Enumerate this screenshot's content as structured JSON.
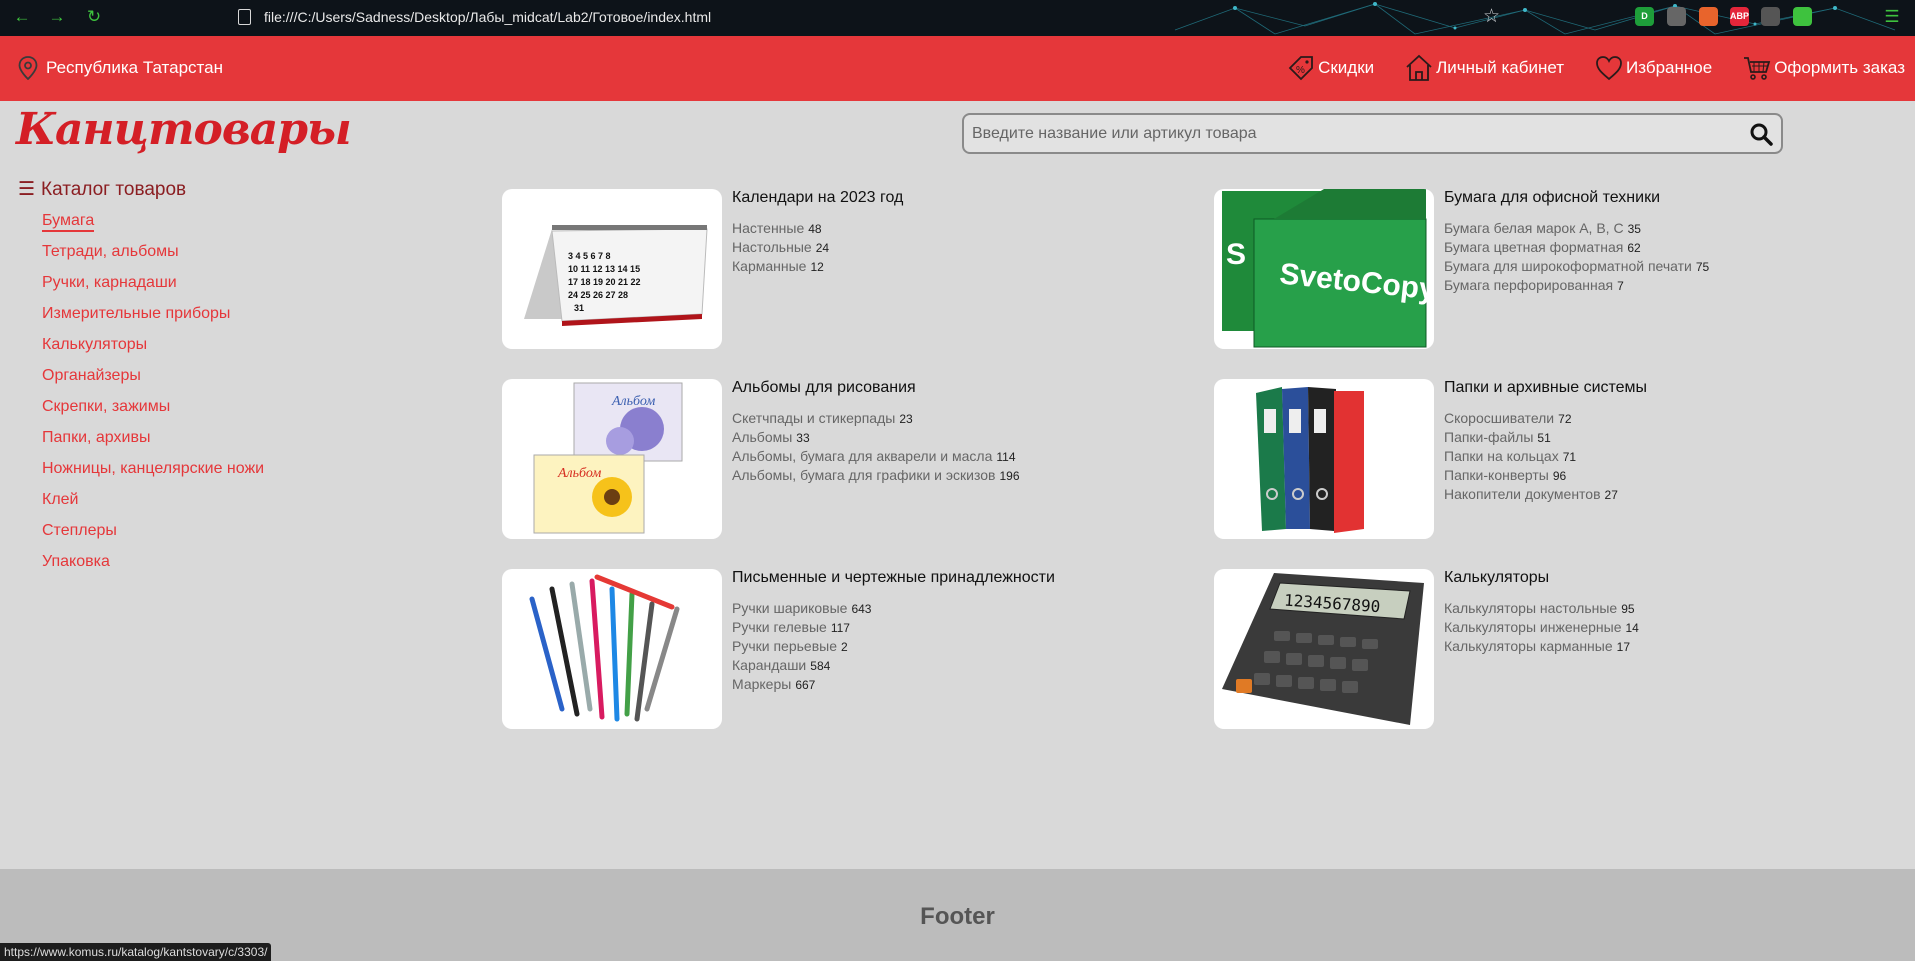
{
  "browser": {
    "url": "file:///C:/Users/Sadness/Desktop/Лабы_midcat/Lab2/Готовое/index.html",
    "status_url": "https://www.komus.ru/katalog/kantstovary/c/3303/",
    "extensions": [
      {
        "label": "D",
        "color": "#1e9e3a"
      },
      {
        "label": "",
        "color": "#666666"
      },
      {
        "label": "",
        "color": "#e8642c"
      },
      {
        "label": "ABP",
        "color": "#e3263a"
      },
      {
        "label": "",
        "color": "#555555"
      },
      {
        "label": "",
        "color": "#3ec23e"
      }
    ]
  },
  "header": {
    "region": "Республика Татарстан",
    "nav": [
      {
        "label": "Скидки",
        "icon": "discount-tag-icon"
      },
      {
        "label": "Личный кабинет",
        "icon": "home-icon"
      },
      {
        "label": "Избранное",
        "icon": "heart-icon"
      },
      {
        "label": "Оформить заказ",
        "icon": "cart-icon"
      }
    ],
    "accent_color": "#e5373a"
  },
  "logo": "Канцтовары",
  "search": {
    "placeholder": "Введите название или артикул товара",
    "value": ""
  },
  "sidebar": {
    "title": "Каталог товаров",
    "items": [
      {
        "label": "Бумага",
        "active": true
      },
      {
        "label": "Тетради, альбомы"
      },
      {
        "label": "Ручки, карнадаши"
      },
      {
        "label": "Измерительные приборы"
      },
      {
        "label": "Калькуляторы"
      },
      {
        "label": "Органайзеры"
      },
      {
        "label": "Скрепки, зажимы"
      },
      {
        "label": "Папки, архивы"
      },
      {
        "label": "Ножницы, канцелярские ножи"
      },
      {
        "label": "Клей"
      },
      {
        "label": "Степлеры"
      },
      {
        "label": "Упаковка"
      }
    ]
  },
  "categories": [
    {
      "title": "Календари на 2023 год",
      "image": "calendar-image",
      "items": [
        {
          "name": "Настенные",
          "count": "48"
        },
        {
          "name": "Настольные",
          "count": "24"
        },
        {
          "name": "Карманные",
          "count": "12"
        }
      ]
    },
    {
      "title": "Бумага для офисной техники",
      "image": "paper-ream-image",
      "items": [
        {
          "name": "Бумага белая марок A, B, C",
          "count": "35"
        },
        {
          "name": "Бумага цветная форматная",
          "count": "62"
        },
        {
          "name": "Бумага для широкоформатной печати",
          "count": "75"
        },
        {
          "name": "Бумага перфорированная",
          "count": "7"
        }
      ]
    },
    {
      "title": "Альбомы для рисования",
      "image": "sketchbook-image",
      "items": [
        {
          "name": "Скетчпады и стикерпады",
          "count": "23"
        },
        {
          "name": "Альбомы",
          "count": "33"
        },
        {
          "name": "Альбомы, бумага для акварели и масла",
          "count": "114"
        },
        {
          "name": "Альбомы, бумага для графики и эскизов",
          "count": "196"
        }
      ]
    },
    {
      "title": "Папки и архивные системы",
      "image": "binders-image",
      "items": [
        {
          "name": "Скоросшиватели",
          "count": "72"
        },
        {
          "name": "Папки-файлы",
          "count": "51"
        },
        {
          "name": "Папки на кольцах",
          "count": "71"
        },
        {
          "name": "Папки-конверты",
          "count": "96"
        },
        {
          "name": "Накопители документов",
          "count": "27"
        }
      ]
    },
    {
      "title": "Письменные и чертежные принадлежности",
      "image": "pens-image",
      "items": [
        {
          "name": "Ручки шариковые",
          "count": "643"
        },
        {
          "name": "Ручки гелевые",
          "count": "117"
        },
        {
          "name": "Ручки перьевые",
          "count": "2"
        },
        {
          "name": "Карандаши",
          "count": "584"
        },
        {
          "name": "Маркеры",
          "count": "667"
        }
      ]
    },
    {
      "title": "Калькуляторы",
      "image": "calculator-image",
      "items": [
        {
          "name": "Калькуляторы настольные",
          "count": "95"
        },
        {
          "name": "Калькуляторы инженерные",
          "count": "14"
        },
        {
          "name": "Калькуляторы карманные",
          "count": "17"
        }
      ]
    }
  ],
  "footer": {
    "label": "Footer"
  }
}
